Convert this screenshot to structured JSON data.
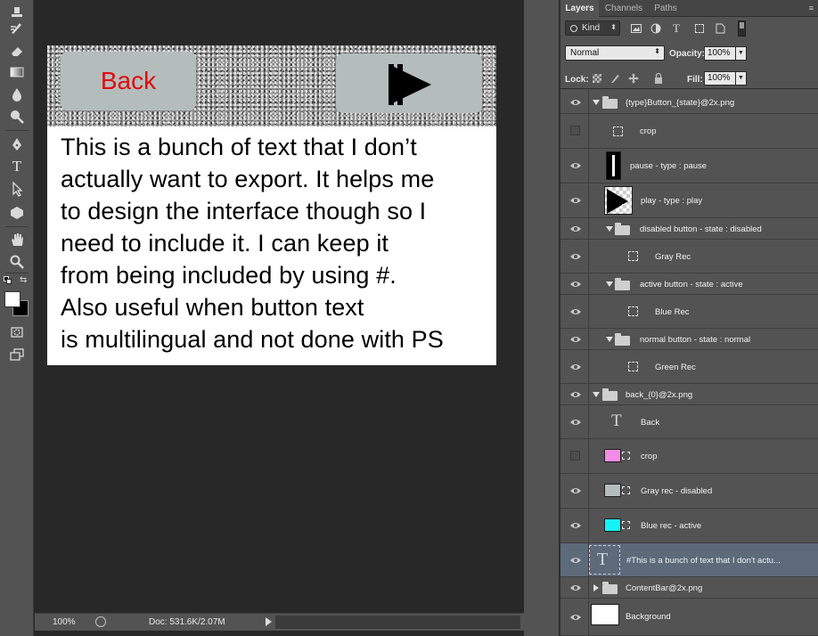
{
  "tools": {
    "items": [
      "move-tool",
      "crop-tool",
      "eraser-tool",
      "gradient-tool",
      "blur-tool",
      "dodge-tool",
      "pen-tool",
      "type-tool",
      "path-selection-tool",
      "shape-tool",
      "hand-tool",
      "zoom-tool",
      "swap-colors",
      "quick-mask",
      "screen-mode"
    ],
    "type_glyph": "T"
  },
  "canvas": {
    "back_label": "Back",
    "helper_lines": [
      "This is a bunch of text that I don’t",
      "actually want to export.  It helps me",
      "to design the interface though so I",
      "need to include it.  I can keep it",
      "from being included by using #.",
      "Also useful when button text",
      "is multilingual and not done with PS"
    ],
    "colors": {
      "back_text": "#e00d0d",
      "button_fill": "#b4bdbc"
    }
  },
  "status": {
    "zoom": "100%",
    "doc_size": "Doc: 531.6K/2.07M"
  },
  "panel": {
    "tabs": [
      "Layers",
      "Channels",
      "Paths"
    ],
    "kind_label": "Kind",
    "type_filter_glyph": "T",
    "blend_mode": "Normal",
    "opacity_label": "Opacity:",
    "opacity_value": "100%",
    "lock_label": "Lock:",
    "fill_label": "Fill:",
    "fill_value": "100%"
  },
  "layers": [
    {
      "name": "{type}Button_{state}@2x.png",
      "kind": "group",
      "open": true,
      "visible": true
    },
    {
      "name": "crop",
      "kind": "shape",
      "visible": false
    },
    {
      "name": "pause - type : pause",
      "kind": "pause-thumb",
      "visible": true
    },
    {
      "name": "play - type : play",
      "kind": "play-thumb",
      "visible": true
    },
    {
      "name": "disabled button - state  : disabled",
      "kind": "group",
      "open": true,
      "visible": true
    },
    {
      "name": "Gray Rec",
      "kind": "shape",
      "visible": true
    },
    {
      "name": "active button - state : active",
      "kind": "group",
      "open": true,
      "visible": true
    },
    {
      "name": "Blue Rec",
      "kind": "shape",
      "visible": true
    },
    {
      "name": "normal button - state : normal",
      "kind": "group",
      "open": true,
      "visible": true
    },
    {
      "name": "Green Rec",
      "kind": "shape",
      "visible": true
    },
    {
      "name": "back_{0}@2x.png",
      "kind": "group",
      "open": true,
      "visible": true
    },
    {
      "name": "Back",
      "kind": "type",
      "visible": true
    },
    {
      "name": "crop",
      "kind": "swatch",
      "color": "#f58be6",
      "visible": false
    },
    {
      "name": "Gray rec - disabled",
      "kind": "swatch",
      "color": "#b4bdbc",
      "visible": true
    },
    {
      "name": "Blue rec - active",
      "kind": "swatch",
      "color": "#14f3f6",
      "visible": true
    },
    {
      "name": "#This is a bunch of text that I don't  actu...",
      "kind": "type-thumb",
      "visible": true,
      "selected": true
    },
    {
      "name": "ContentBar@2x.png",
      "kind": "group",
      "open": false,
      "visible": true
    },
    {
      "name": "Background",
      "kind": "bg-thumb",
      "visible": true
    }
  ]
}
